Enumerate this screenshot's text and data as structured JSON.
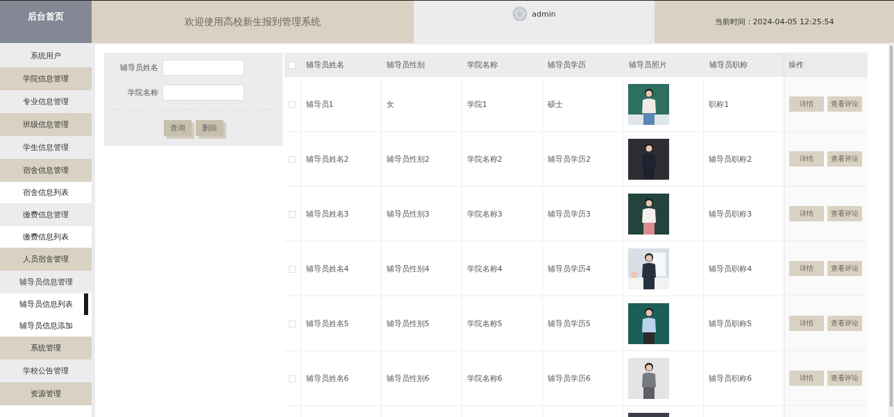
{
  "header": {
    "home": "后台首页",
    "title": "欢迎使用高校新生报到管理系统",
    "user": "admin",
    "time_label": "当前时间：",
    "time": "2024-04-05 12:25:54"
  },
  "sidebar": {
    "items": [
      {
        "label": "系统用户"
      },
      {
        "label": "学院信息管理"
      },
      {
        "label": "专业信息管理"
      },
      {
        "label": "班级信息管理"
      },
      {
        "label": "学生信息管理"
      },
      {
        "label": "宿舍信息管理",
        "children": [
          {
            "label": "宿舍信息列表",
            "selected": false
          }
        ]
      },
      {
        "label": "缴费信息管理",
        "children": [
          {
            "label": "缴费信息列表",
            "selected": false
          }
        ]
      },
      {
        "label": "人员宿舍管理"
      },
      {
        "label": "辅导员信息管理",
        "children": [
          {
            "label": "辅导员信息列表",
            "selected": true
          },
          {
            "label": "辅导员信息添加",
            "selected": false
          }
        ]
      },
      {
        "label": "系统管理"
      },
      {
        "label": "学校公告管理"
      },
      {
        "label": "资源管理"
      }
    ]
  },
  "search": {
    "fields": [
      {
        "label": "辅导员姓名"
      },
      {
        "label": "学院名称"
      }
    ],
    "buttons": [
      "查询",
      "删除"
    ]
  },
  "table": {
    "all_checked": false,
    "columns": [
      "辅导员姓名",
      "辅导员性别",
      "学院名称",
      "辅导员学历",
      "辅导员照片",
      "辅导员职称",
      "操作"
    ],
    "rows": [
      {
        "checked": false,
        "cells": [
          "辅导员1",
          "女",
          "学院1",
          "硕士",
          "职称1"
        ],
        "photo": {
          "kind": "picture"
        },
        "actions": [
          "详情",
          "查看评论"
        ]
      },
      {
        "checked": false,
        "cells": [
          "辅导员姓名2",
          "辅导员性别2",
          "学院名称2",
          "辅导员学历2",
          "辅导员职称2"
        ],
        "photo": {
          "kind": "picture"
        },
        "actions": [
          "详情",
          "查看评论"
        ]
      },
      {
        "checked": false,
        "cells": [
          "辅导员姓名3",
          "辅导员性别3",
          "学院名称3",
          "辅导员学历3",
          "辅导员职称3"
        ],
        "photo": {
          "kind": "picture"
        },
        "actions": [
          "详情",
          "查看评论"
        ]
      },
      {
        "checked": false,
        "cells": [
          "辅导员姓名4",
          "辅导员性别4",
          "学院名称4",
          "辅导员学历4",
          "辅导员职称4"
        ],
        "photo": {
          "kind": "picture"
        },
        "actions": [
          "详情",
          "查看评论"
        ]
      },
      {
        "checked": false,
        "cells": [
          "辅导员姓名5",
          "辅导员性别5",
          "学院名称5",
          "辅导员学历5",
          "辅导员职称5"
        ],
        "photo": {
          "kind": "picture"
        },
        "actions": [
          "详情",
          "查看评论"
        ]
      },
      {
        "checked": false,
        "cells": [
          "辅导员姓名6",
          "辅导员性别6",
          "学院名称6",
          "辅导员学历6",
          "辅导员职称6"
        ],
        "photo": {
          "kind": "picture"
        },
        "actions": [
          "详情",
          "查看评论"
        ]
      }
    ],
    "partial_row": {
      "photo": {
        "kind": "picture"
      }
    }
  }
}
